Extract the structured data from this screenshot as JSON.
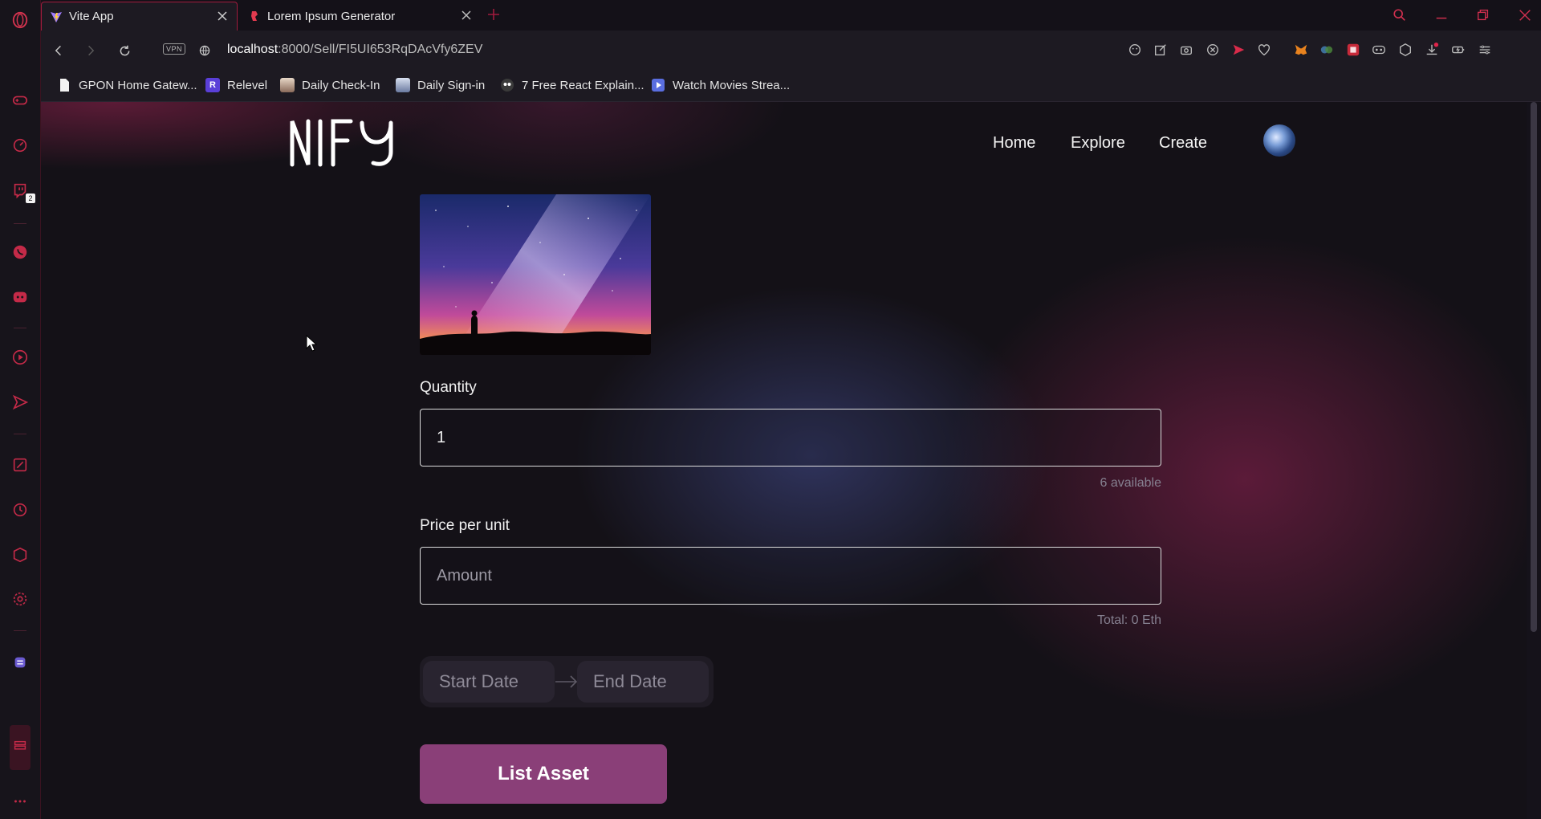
{
  "browser": {
    "tabs": [
      {
        "label": "Vite App",
        "active": true
      },
      {
        "label": "Lorem Ipsum Generator",
        "active": false
      }
    ],
    "url": {
      "host": "localhost",
      "path": ":8000/Sell/FI5UI653RqDAcVfy6ZEV"
    },
    "vpn_label": "VPN",
    "bookmarks": [
      {
        "label": "GPON Home Gatew...",
        "icon": "page-icon"
      },
      {
        "label": "Relevel",
        "icon": "relevel-icon"
      },
      {
        "label": "Daily Check-In",
        "icon": "anime-avatar-icon"
      },
      {
        "label": "Daily Sign-in",
        "icon": "anime-avatar-icon"
      },
      {
        "label": "7 Free React Explain...",
        "icon": "owl-icon"
      },
      {
        "label": "Watch Movies Strea...",
        "icon": "play-icon"
      }
    ],
    "sidebar_badge": "2",
    "accent_color": "#a01b3d"
  },
  "site": {
    "nav": {
      "home": "Home",
      "explore": "Explore",
      "create": "Create"
    }
  },
  "form": {
    "quantity_label": "Quantity",
    "quantity_value": "1",
    "available": "6 available",
    "price_label": "Price per unit",
    "price_placeholder": "Amount",
    "total": "Total: 0 Eth",
    "start_date": "Start Date",
    "end_date": "End Date",
    "submit_label": "List Asset",
    "submit_color": "#8a3f78"
  }
}
